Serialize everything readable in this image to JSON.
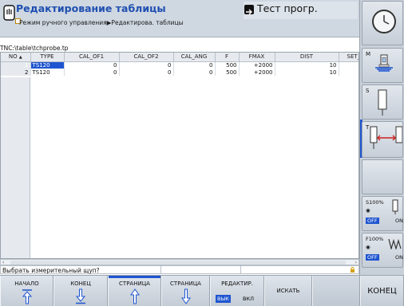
{
  "header": {
    "mode_title": "Редактирование таблицы",
    "breadcrumb": "Режим ручного управления▶Редактирова. таблицы",
    "program_title": "Тест прогр."
  },
  "path": "TNC:\\table\\tchprobe.tp",
  "table": {
    "columns": [
      "NO",
      "TYPE",
      "CAL_OF1",
      "CAL_OF2",
      "CAL_ANG",
      "F",
      "FMAX",
      "DIST",
      "SET_UP"
    ],
    "sort_indicator": "▲",
    "rows": [
      {
        "no": "1",
        "type": "TS120",
        "cal_of1": "0",
        "cal_of2": "0",
        "cal_ang": "0",
        "f": "500",
        "fmax": "+2000",
        "dist": "10",
        "set_up": ""
      },
      {
        "no": "2",
        "type": "TS120",
        "cal_of1": "0",
        "cal_of2": "0",
        "cal_ang": "0",
        "f": "500",
        "fmax": "+2000",
        "dist": "10",
        "set_up": ""
      }
    ]
  },
  "status": {
    "prompt": "Выбрать измерительный щуп?"
  },
  "softkeys": [
    {
      "label": "НАЧАЛО",
      "icon": "arrow-up-bar-icon"
    },
    {
      "label": "КОНЕЦ",
      "icon": "arrow-down-bar-icon"
    },
    {
      "label": "СТРАНИЦА",
      "icon": "arrow-up-icon"
    },
    {
      "label": "СТРАНИЦА",
      "icon": "arrow-down-icon"
    },
    {
      "label": "РЕДАКТИР.",
      "sub_off": "ВЫК",
      "sub_on": "ВКЛ"
    },
    {
      "label": "ИСКАТЬ"
    },
    {
      "label": ""
    },
    {
      "label": "КОНЕЦ"
    }
  ],
  "side": {
    "m_label": "M",
    "s_label": "S",
    "t_label": "T",
    "s_override": "S100%",
    "f_override": "F100%",
    "off": "OFF",
    "on": "ON"
  },
  "colors": {
    "accent": "#1f55d0",
    "title": "#1e4fb0"
  }
}
